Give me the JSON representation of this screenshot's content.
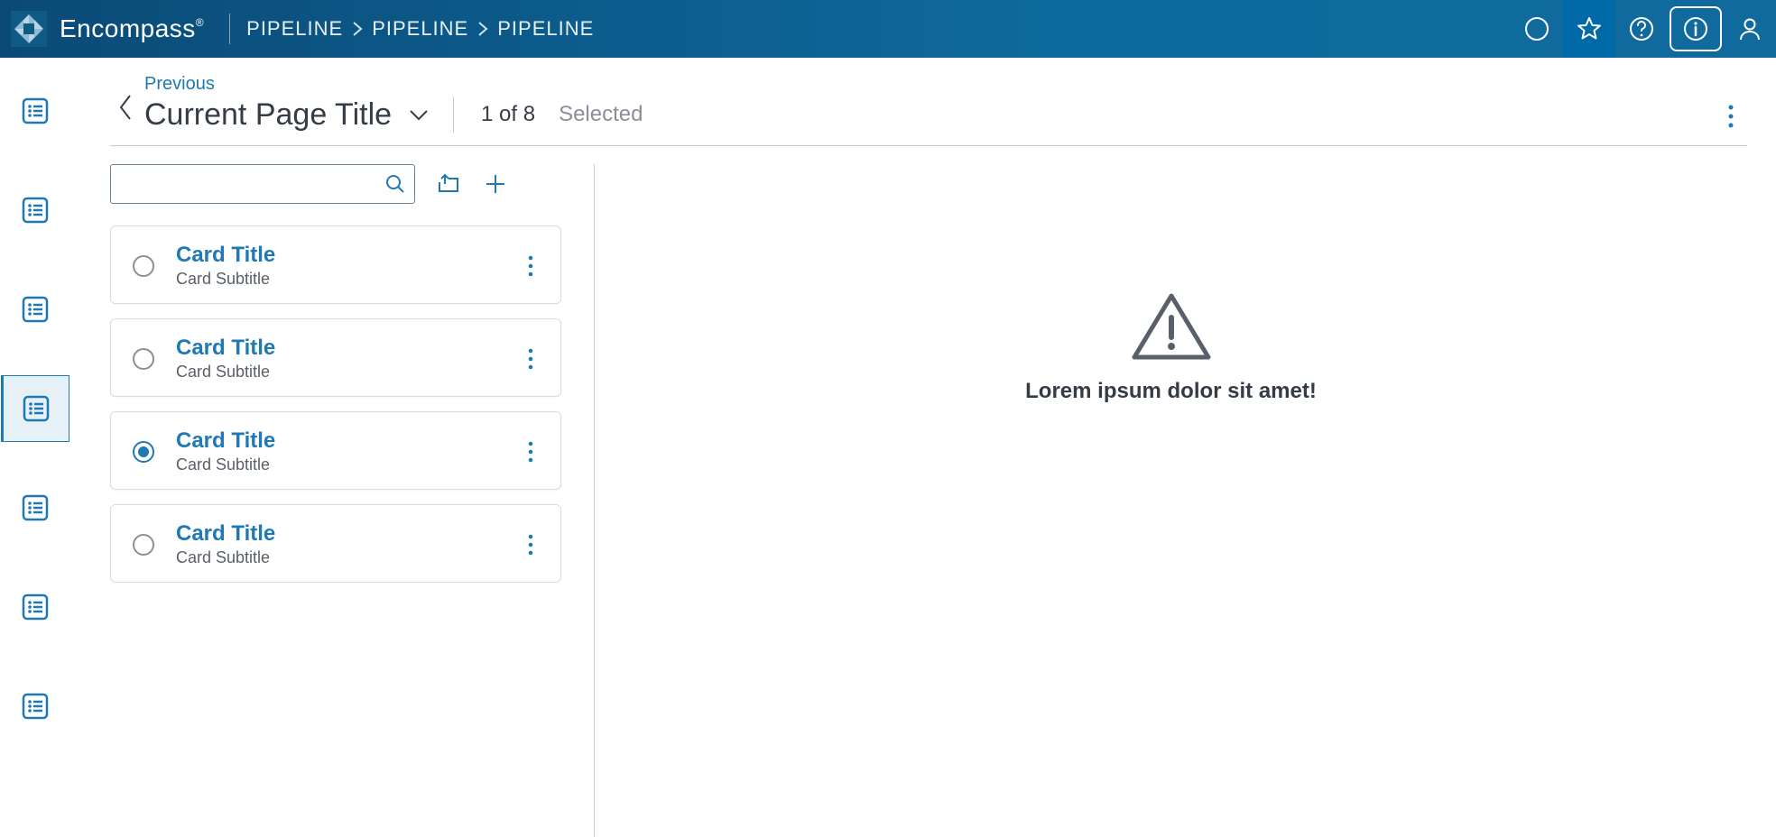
{
  "brand": {
    "name": "Encompass",
    "reg": "®"
  },
  "breadcrumbs": [
    "PIPELINE",
    "PIPELINE",
    "PIPELINE"
  ],
  "leftrail": {
    "activeIndex": 3,
    "count": 7
  },
  "pageHeader": {
    "previousLabel": "Previous",
    "title": "Current Page Title",
    "count": "1 of 8",
    "selectedLabel": "Selected"
  },
  "search": {
    "value": ""
  },
  "cards": [
    {
      "title": "Card Title",
      "subtitle": "Card Subtitle",
      "selected": false
    },
    {
      "title": "Card Title",
      "subtitle": "Card Subtitle",
      "selected": false
    },
    {
      "title": "Card Title",
      "subtitle": "Card Subtitle",
      "selected": true
    },
    {
      "title": "Card Title",
      "subtitle": "Card Subtitle",
      "selected": false
    }
  ],
  "errorMessage": "Lorem ipsum dolor sit amet!"
}
